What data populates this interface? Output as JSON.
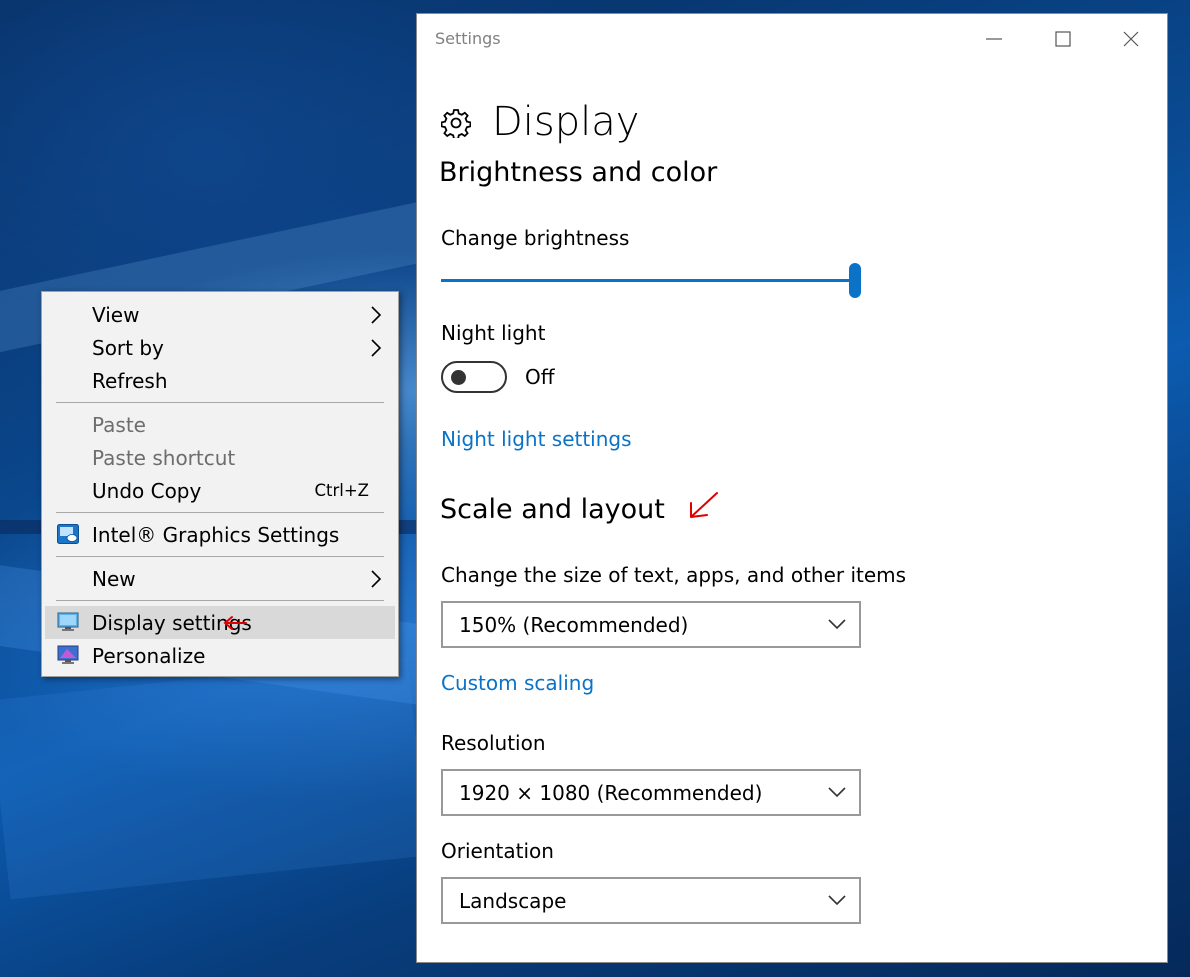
{
  "context_menu": {
    "items": [
      {
        "label": "View",
        "submenu": true
      },
      {
        "label": "Sort by",
        "submenu": true
      },
      {
        "label": "Refresh"
      },
      {
        "label": "Paste",
        "disabled": true
      },
      {
        "label": "Paste shortcut",
        "disabled": true
      },
      {
        "label": "Undo Copy",
        "shortcut": "Ctrl+Z"
      },
      {
        "label": "Intel® Graphics Settings",
        "icon": "intel-graphics-icon"
      },
      {
        "label": "New",
        "submenu": true
      },
      {
        "label": "Display settings",
        "icon": "display-settings-icon",
        "highlighted": true
      },
      {
        "label": "Personalize",
        "icon": "personalize-icon"
      }
    ]
  },
  "settings": {
    "window_title": "Settings",
    "page_title": "Display",
    "page_icon": "gear-icon",
    "brightness_section": {
      "heading": "Brightness and color",
      "brightness_label": "Change brightness",
      "brightness_level": 1.0,
      "night_light_label": "Night light",
      "night_light_state": "Off",
      "night_light_link": "Night light settings"
    },
    "scale_section": {
      "heading": "Scale and layout",
      "size_label": "Change the size of text, apps, and other items",
      "size_value": "150% (Recommended)",
      "custom_scaling_link": "Custom scaling",
      "resolution_label": "Resolution",
      "resolution_value": "1920 × 1080 (Recommended)",
      "orientation_label": "Orientation",
      "orientation_value": "Landscape"
    }
  },
  "colors": {
    "accent": "#0a73c8",
    "annotation": "#e00000",
    "menu_highlight": "#d9d9d9"
  }
}
